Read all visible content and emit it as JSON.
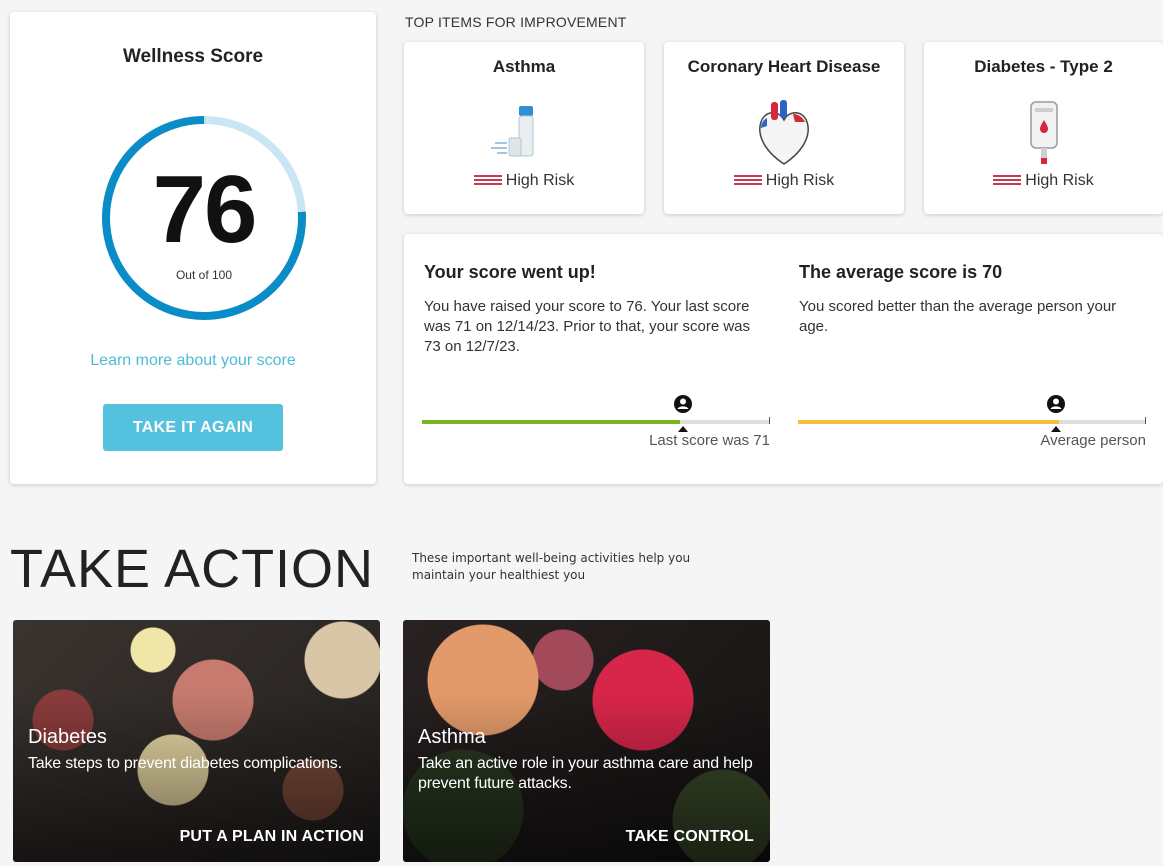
{
  "wellness": {
    "title": "Wellness Score",
    "score": "76",
    "score_max_label": "Out of 100",
    "score_fraction": 0.76,
    "learn_link": "Learn more about your score",
    "take_again_label": "TAKE IT AGAIN"
  },
  "improvement": {
    "section_label": "TOP ITEMS FOR IMPROVEMENT",
    "items": [
      {
        "title": "Asthma",
        "risk": "High Risk",
        "icon": "inhaler-icon"
      },
      {
        "title": "Coronary Heart Disease",
        "risk": "High Risk",
        "icon": "heart-icon"
      },
      {
        "title": "Diabetes - Type 2",
        "risk": "High Risk",
        "icon": "glucose-meter-icon"
      }
    ]
  },
  "score_info": {
    "left": {
      "heading": "Your score went up!",
      "body": "You have raised your score to 76. Your last score was 71 on 12/14/23. Prior to that, your score was 73 on 12/7/23.",
      "marker_label": "Last score was 71",
      "fill_fraction": 0.74,
      "marker_fraction": 0.71,
      "fill_color": "#7ab51d"
    },
    "right": {
      "heading": "The average score is 70",
      "body": "You scored better than the average person your age.",
      "marker_label": "Average person",
      "fill_fraction": 0.75,
      "marker_fraction": 0.7,
      "fill_color": "#f7be3b"
    }
  },
  "take_action": {
    "title": "TAKE ACTION",
    "description": "These important well-being activities help you maintain your healthiest you",
    "cards": [
      {
        "title": "Diabetes",
        "text": "Take steps to prevent diabetes complications.",
        "cta": "PUT A PLAN IN ACTION"
      },
      {
        "title": "Asthma",
        "text": "Take an active role in your asthma care and help prevent future attacks.",
        "cta": "TAKE CONTROL"
      }
    ]
  },
  "colors": {
    "accent": "#54c2de",
    "gauge_fg": "#0a8cc6",
    "gauge_bg": "#c9e6f3",
    "risk": "#c63a52"
  }
}
